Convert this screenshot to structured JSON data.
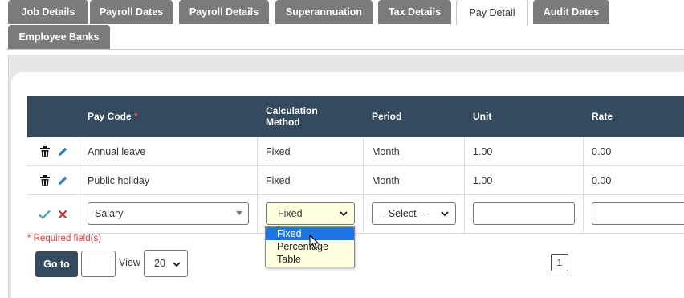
{
  "tabs": [
    {
      "label": "Job Details"
    },
    {
      "label": "Payroll Dates"
    },
    {
      "label": "Payroll Details"
    },
    {
      "label": "Superannuation"
    },
    {
      "label": "Tax Details"
    },
    {
      "label": "Pay Detail",
      "active": true
    },
    {
      "label": "Audit Dates"
    },
    {
      "label": "Employee Banks"
    }
  ],
  "grid": {
    "columns": {
      "pay_code": "Pay Code",
      "pay_code_required": "*",
      "calc_method_line1": "Calculation",
      "calc_method_line2": "Method",
      "period": "Period",
      "unit": "Unit",
      "rate": "Rate"
    },
    "rows": [
      {
        "pay_code": "Annual leave",
        "calc_method": "Fixed",
        "period": "Month",
        "unit": "1.00",
        "rate": "0.00"
      },
      {
        "pay_code": "Public holiday",
        "calc_method": "Fixed",
        "period": "Month",
        "unit": "1.00",
        "rate": "0.00"
      }
    ],
    "edit_row": {
      "pay_code_value": "Salary",
      "calc_method_value": "Fixed",
      "period_value": "-- Select --",
      "unit_value": "",
      "rate_value": ""
    }
  },
  "dropdown_options": [
    "Fixed",
    "Percentage",
    "Table"
  ],
  "dropdown_selected": "Fixed",
  "required_note": "* Required field(s)",
  "pager": {
    "goto_label": "Go to",
    "page_input": "",
    "view_label": "View",
    "page_size": "20",
    "current_page": "1"
  },
  "colors": {
    "tab_bg": "#7b7b7b",
    "header_bg": "#344a5e",
    "required": "#d83a3a",
    "dropdown_bg": "#ffffe0",
    "option_selected": "#1e74e4",
    "check": "#3aa0c8",
    "cross": "#d63030",
    "pencil": "#2f7fc1"
  }
}
